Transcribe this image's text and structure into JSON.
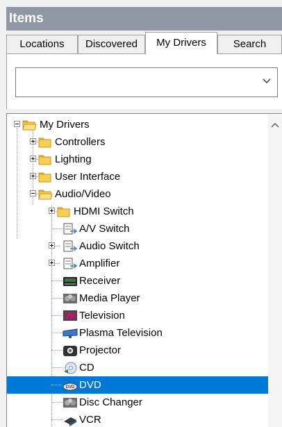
{
  "panel": {
    "title": "Items"
  },
  "tabs": [
    {
      "label": "Locations"
    },
    {
      "label": "Discovered"
    },
    {
      "label": "My Drivers"
    },
    {
      "label": "Search"
    }
  ],
  "filter": {
    "value": ""
  },
  "tree": {
    "items": [
      {
        "label": "My Drivers",
        "icon": "folder-icon"
      },
      {
        "label": "Controllers",
        "icon": "folder-icon"
      },
      {
        "label": "Lighting",
        "icon": "folder-icon"
      },
      {
        "label": "User Interface",
        "icon": "folder-icon"
      },
      {
        "label": "Audio/Video",
        "icon": "folder-icon"
      },
      {
        "label": "HDMI Switch",
        "icon": "folder-icon"
      },
      {
        "label": "A/V Switch",
        "icon": "av-switch-icon"
      },
      {
        "label": "Audio Switch",
        "icon": "audio-switch-icon"
      },
      {
        "label": "Amplifier",
        "icon": "amplifier-icon"
      },
      {
        "label": "Receiver",
        "icon": "receiver-icon"
      },
      {
        "label": "Media Player",
        "icon": "media-player-icon"
      },
      {
        "label": "Television",
        "icon": "television-icon"
      },
      {
        "label": "Plasma Television",
        "icon": "plasma-television-icon"
      },
      {
        "label": "Projector",
        "icon": "projector-icon"
      },
      {
        "label": "CD",
        "icon": "cd-icon"
      },
      {
        "label": "DVD",
        "icon": "dvd-icon"
      },
      {
        "label": "Disc Changer",
        "icon": "disc-changer-icon"
      },
      {
        "label": "VCR",
        "icon": "vcr-icon"
      }
    ],
    "selected": "DVD"
  },
  "colors": {
    "header": "#8f99a6",
    "selection": "#0078d7",
    "folder": "#f7cf56"
  }
}
